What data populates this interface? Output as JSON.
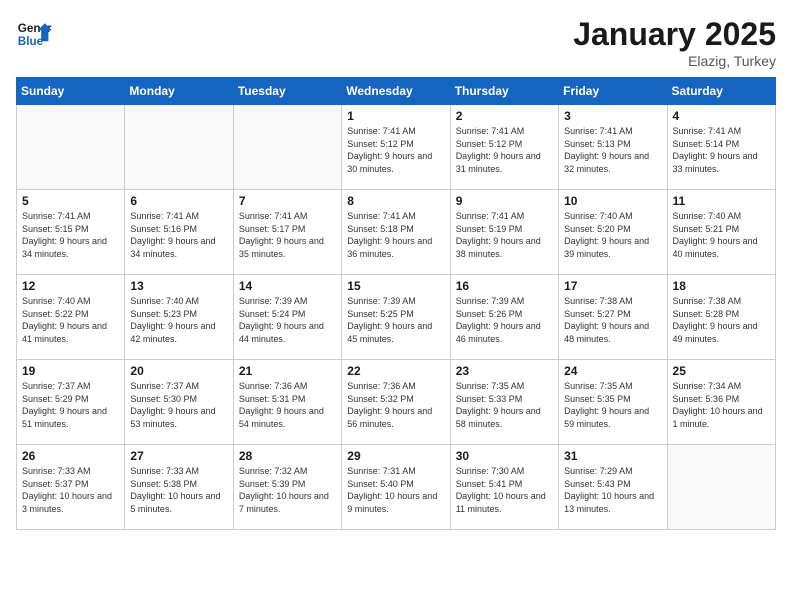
{
  "header": {
    "logo_line1": "General",
    "logo_line2": "Blue",
    "month": "January 2025",
    "location": "Elazig, Turkey"
  },
  "weekdays": [
    "Sunday",
    "Monday",
    "Tuesday",
    "Wednesday",
    "Thursday",
    "Friday",
    "Saturday"
  ],
  "weeks": [
    [
      {
        "day": "",
        "info": ""
      },
      {
        "day": "",
        "info": ""
      },
      {
        "day": "",
        "info": ""
      },
      {
        "day": "1",
        "info": "Sunrise: 7:41 AM\nSunset: 5:12 PM\nDaylight: 9 hours\nand 30 minutes."
      },
      {
        "day": "2",
        "info": "Sunrise: 7:41 AM\nSunset: 5:12 PM\nDaylight: 9 hours\nand 31 minutes."
      },
      {
        "day": "3",
        "info": "Sunrise: 7:41 AM\nSunset: 5:13 PM\nDaylight: 9 hours\nand 32 minutes."
      },
      {
        "day": "4",
        "info": "Sunrise: 7:41 AM\nSunset: 5:14 PM\nDaylight: 9 hours\nand 33 minutes."
      }
    ],
    [
      {
        "day": "5",
        "info": "Sunrise: 7:41 AM\nSunset: 5:15 PM\nDaylight: 9 hours\nand 34 minutes."
      },
      {
        "day": "6",
        "info": "Sunrise: 7:41 AM\nSunset: 5:16 PM\nDaylight: 9 hours\nand 34 minutes."
      },
      {
        "day": "7",
        "info": "Sunrise: 7:41 AM\nSunset: 5:17 PM\nDaylight: 9 hours\nand 35 minutes."
      },
      {
        "day": "8",
        "info": "Sunrise: 7:41 AM\nSunset: 5:18 PM\nDaylight: 9 hours\nand 36 minutes."
      },
      {
        "day": "9",
        "info": "Sunrise: 7:41 AM\nSunset: 5:19 PM\nDaylight: 9 hours\nand 38 minutes."
      },
      {
        "day": "10",
        "info": "Sunrise: 7:40 AM\nSunset: 5:20 PM\nDaylight: 9 hours\nand 39 minutes."
      },
      {
        "day": "11",
        "info": "Sunrise: 7:40 AM\nSunset: 5:21 PM\nDaylight: 9 hours\nand 40 minutes."
      }
    ],
    [
      {
        "day": "12",
        "info": "Sunrise: 7:40 AM\nSunset: 5:22 PM\nDaylight: 9 hours\nand 41 minutes."
      },
      {
        "day": "13",
        "info": "Sunrise: 7:40 AM\nSunset: 5:23 PM\nDaylight: 9 hours\nand 42 minutes."
      },
      {
        "day": "14",
        "info": "Sunrise: 7:39 AM\nSunset: 5:24 PM\nDaylight: 9 hours\nand 44 minutes."
      },
      {
        "day": "15",
        "info": "Sunrise: 7:39 AM\nSunset: 5:25 PM\nDaylight: 9 hours\nand 45 minutes."
      },
      {
        "day": "16",
        "info": "Sunrise: 7:39 AM\nSunset: 5:26 PM\nDaylight: 9 hours\nand 46 minutes."
      },
      {
        "day": "17",
        "info": "Sunrise: 7:38 AM\nSunset: 5:27 PM\nDaylight: 9 hours\nand 48 minutes."
      },
      {
        "day": "18",
        "info": "Sunrise: 7:38 AM\nSunset: 5:28 PM\nDaylight: 9 hours\nand 49 minutes."
      }
    ],
    [
      {
        "day": "19",
        "info": "Sunrise: 7:37 AM\nSunset: 5:29 PM\nDaylight: 9 hours\nand 51 minutes."
      },
      {
        "day": "20",
        "info": "Sunrise: 7:37 AM\nSunset: 5:30 PM\nDaylight: 9 hours\nand 53 minutes."
      },
      {
        "day": "21",
        "info": "Sunrise: 7:36 AM\nSunset: 5:31 PM\nDaylight: 9 hours\nand 54 minutes."
      },
      {
        "day": "22",
        "info": "Sunrise: 7:36 AM\nSunset: 5:32 PM\nDaylight: 9 hours\nand 56 minutes."
      },
      {
        "day": "23",
        "info": "Sunrise: 7:35 AM\nSunset: 5:33 PM\nDaylight: 9 hours\nand 58 minutes."
      },
      {
        "day": "24",
        "info": "Sunrise: 7:35 AM\nSunset: 5:35 PM\nDaylight: 9 hours\nand 59 minutes."
      },
      {
        "day": "25",
        "info": "Sunrise: 7:34 AM\nSunset: 5:36 PM\nDaylight: 10 hours\nand 1 minute."
      }
    ],
    [
      {
        "day": "26",
        "info": "Sunrise: 7:33 AM\nSunset: 5:37 PM\nDaylight: 10 hours\nand 3 minutes."
      },
      {
        "day": "27",
        "info": "Sunrise: 7:33 AM\nSunset: 5:38 PM\nDaylight: 10 hours\nand 5 minutes."
      },
      {
        "day": "28",
        "info": "Sunrise: 7:32 AM\nSunset: 5:39 PM\nDaylight: 10 hours\nand 7 minutes."
      },
      {
        "day": "29",
        "info": "Sunrise: 7:31 AM\nSunset: 5:40 PM\nDaylight: 10 hours\nand 9 minutes."
      },
      {
        "day": "30",
        "info": "Sunrise: 7:30 AM\nSunset: 5:41 PM\nDaylight: 10 hours\nand 11 minutes."
      },
      {
        "day": "31",
        "info": "Sunrise: 7:29 AM\nSunset: 5:43 PM\nDaylight: 10 hours\nand 13 minutes."
      },
      {
        "day": "",
        "info": ""
      }
    ]
  ]
}
